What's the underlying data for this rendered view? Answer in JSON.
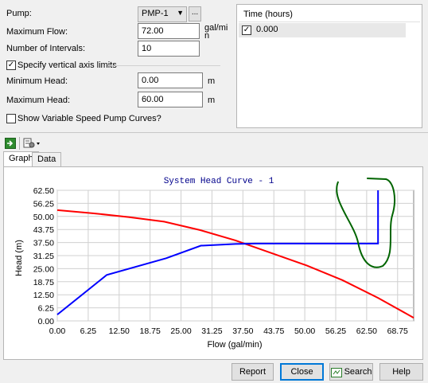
{
  "form": {
    "pump_label": "Pump:",
    "pump_value": "PMP-1",
    "pump_browse": "...",
    "max_flow_label": "Maximum Flow:",
    "max_flow_value": "72.00",
    "max_flow_unit_line1": "gal/mi",
    "max_flow_unit_line2": "n",
    "intervals_label": "Number of Intervals:",
    "intervals_value": "10",
    "specify_limits_label": "Specify vertical axis limits",
    "specify_limits_checked": true,
    "min_head_label": "Minimum Head:",
    "min_head_value": "0.00",
    "min_head_unit": "m",
    "max_head_label": "Maximum Head:",
    "max_head_value": "60.00",
    "max_head_unit": "m",
    "variable_speed_label": "Show Variable Speed Pump Curves?",
    "variable_speed_checked": false
  },
  "time_list": {
    "header": "Time (hours)",
    "rows": [
      {
        "label": "0.000",
        "checked": true
      }
    ]
  },
  "tabs": [
    {
      "label": "Graph",
      "active": true
    },
    {
      "label": "Data",
      "active": false
    }
  ],
  "buttons": {
    "report": "Report",
    "close": "Close",
    "search": "Search",
    "help": "Help"
  },
  "colors": {
    "pump_curve": "#ff0000",
    "system_curve": "#0000ff",
    "annotation": "#006400",
    "title": "#00008b"
  },
  "chart_data": {
    "type": "line",
    "title": "System Head Curve - 1",
    "xlabel": "Flow (gal/min)",
    "ylabel": "Head (m)",
    "xlim": [
      0,
      72
    ],
    "ylim": [
      0,
      62.5
    ],
    "x_ticks": [
      "0.00",
      "6.25",
      "12.50",
      "18.75",
      "25.00",
      "31.25",
      "37.50",
      "43.75",
      "50.00",
      "56.25",
      "62.50",
      "68.75"
    ],
    "y_ticks": [
      "62.50",
      "56.25",
      "50.00",
      "43.75",
      "37.50",
      "31.25",
      "25.00",
      "18.75",
      "12.50",
      "6.25",
      "0.00"
    ],
    "grid": true,
    "series": [
      {
        "color": "#ff0000",
        "x": [
          0,
          7.2,
          14.4,
          21.6,
          28.8,
          36,
          43.2,
          50.4,
          57.6,
          64.8,
          72
        ],
        "y": [
          53,
          51.5,
          49.7,
          47.5,
          43.5,
          38.5,
          32.5,
          26.5,
          19.5,
          11,
          1.5
        ]
      },
      {
        "color": "#0000ff",
        "x": [
          0,
          10,
          22,
          29,
          36,
          40,
          64.8,
          64.8
        ],
        "y": [
          3,
          22,
          30,
          36,
          36.8,
          37,
          37,
          62.5
        ]
      }
    ],
    "annotation": "hand-drawn green loop around vertical segment near flow 64.8"
  }
}
